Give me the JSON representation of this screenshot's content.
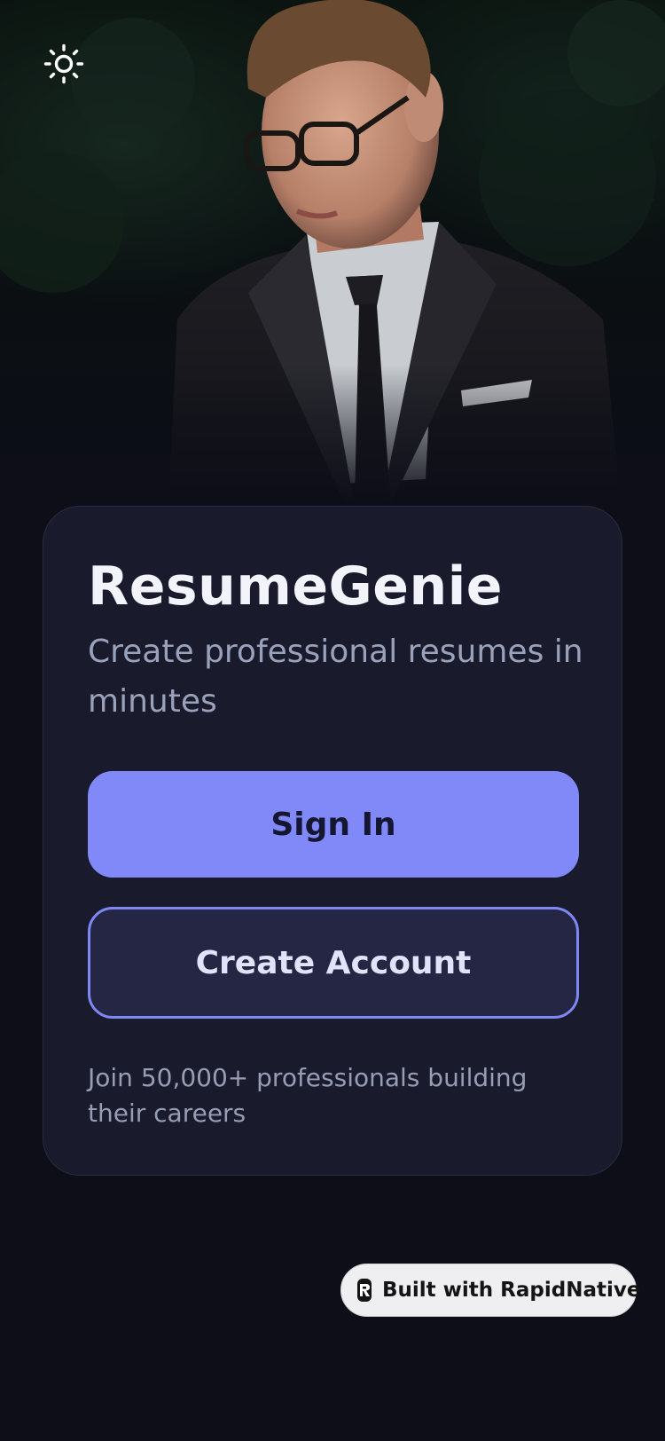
{
  "app": {
    "title": "ResumeGenie",
    "tagline": "Create professional resumes in minutes"
  },
  "header": {
    "theme_toggle_icon": "sun-icon"
  },
  "actions": {
    "sign_in_label": "Sign In",
    "create_account_label": "Create Account"
  },
  "footer_note": "Join 50,000+ professionals building their careers",
  "badge": {
    "label": "Built with RapidNative",
    "icon": "rapidnative-logo-icon"
  },
  "colors": {
    "background": "#0d0e18",
    "card": "#191a2b",
    "accent": "#8189f9",
    "secondary_button": "#252643",
    "title_text": "#f2f3fb",
    "muted_text": "#99a1bb"
  },
  "hero_image": "man-in-suit-photo"
}
